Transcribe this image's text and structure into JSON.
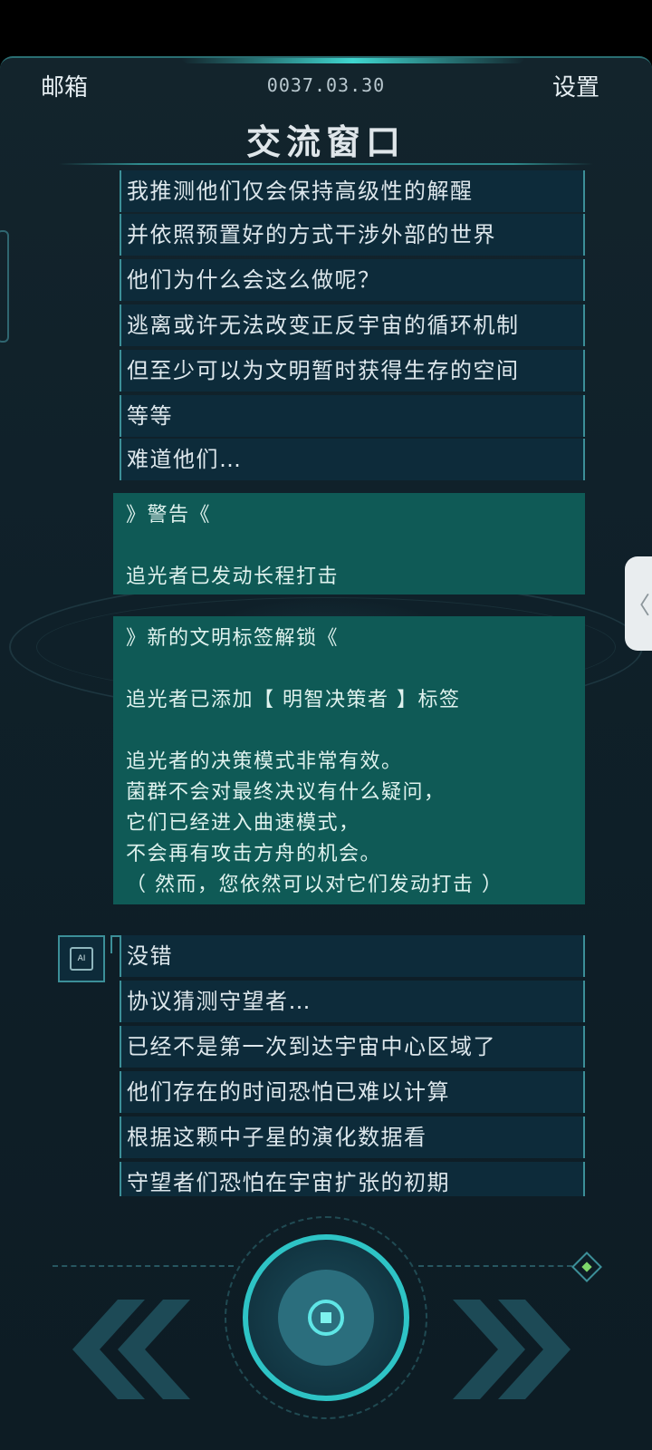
{
  "header": {
    "mailbox_label": "邮箱",
    "date": "0037.03.30",
    "settings_label": "设置",
    "title": "交流窗口"
  },
  "messages_top": [
    "我推测他们仅会保持高级性的解醒",
    "并依照预置好的方式干涉外部的世界",
    "他们为什么会这么做呢？",
    "逃离或许无法改变正反宇宙的循环机制",
    "但至少可以为文明暂时获得生存的空间",
    "等等",
    "难道他们…"
  ],
  "warning_box": {
    "heading": "》警告《",
    "line": "追光者已发动长程打击"
  },
  "unlock_box": {
    "heading": "》新的文明标签解锁《",
    "added": "追光者已添加【 明智决策者 】标签",
    "body": [
      "追光者的决策模式非常有效。",
      "菌群不会对最终决议有什么疑问，",
      "它们已经进入曲速模式，",
      "不会再有攻击方舟的机会。",
      "（ 然而，您依然可以对它们发动打击 ）"
    ]
  },
  "ai_avatar_label": "AI",
  "messages_ai": [
    "没错",
    "协议猜测守望者…",
    "已经不是第一次到达宇宙中心区域了",
    "他们存在的时间恐怕已难以计算",
    "根据这颗中子星的演化数据看",
    "守望者们恐怕在宇宙扩张的初期"
  ],
  "controls": {
    "prev_icon": "double-chevron-left-icon",
    "next_icon": "double-chevron-right-icon",
    "center_icon": "core-button-icon",
    "handle_glyph": "〈"
  }
}
